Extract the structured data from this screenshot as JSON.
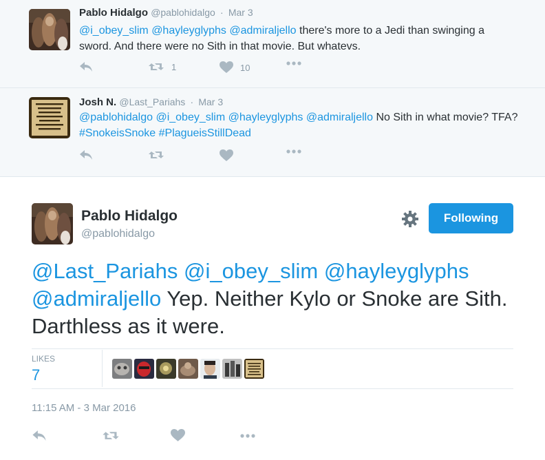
{
  "replies": [
    {
      "name": "Pablo Hidalgo",
      "handle": "@pablohidalgo",
      "date": "Mar 3",
      "text_segments": [
        {
          "text": "@i_obey_slim",
          "link": true
        },
        {
          "text": " ",
          "link": false
        },
        {
          "text": "@hayleyglyphs",
          "link": true
        },
        {
          "text": " ",
          "link": false
        },
        {
          "text": "@admiraljello",
          "link": true
        },
        {
          "text": " there's more to a Jedi than swinging a sword. And there were no Sith in that movie. But whatevs.",
          "link": false
        }
      ],
      "retweets": "1",
      "likes": "10",
      "avatar_icon": "hooded-figures-avatar"
    },
    {
      "name": "Josh N.",
      "handle": "@Last_Pariahs",
      "date": "Mar 3",
      "text_segments": [
        {
          "text": "@pablohidalgo",
          "link": true
        },
        {
          "text": " ",
          "link": false
        },
        {
          "text": "@i_obey_slim",
          "link": true
        },
        {
          "text": " ",
          "link": false
        },
        {
          "text": "@hayleyglyphs",
          "link": true
        },
        {
          "text": " ",
          "link": false
        },
        {
          "text": "@admiraljello",
          "link": true
        },
        {
          "text": " No Sith in what movie? TFA? ",
          "link": false
        },
        {
          "text": "#SnokeisSnoke",
          "link": true
        },
        {
          "text": " ",
          "link": false
        },
        {
          "text": "#PlagueisStillDead",
          "link": true
        }
      ],
      "retweets": "",
      "likes": "",
      "avatar_icon": "text-poster-avatar",
      "avatar_text": "PEOPLE DON'T COME TO HERE THE TRUTH BECAUSE THEY DON'T WANT THEIR ILLUSIONS DESTROYED."
    }
  ],
  "main_tweet": {
    "name": "Pablo Hidalgo",
    "handle": "@pablohidalgo",
    "follow_label": "Following",
    "text_segments": [
      {
        "text": "@Last_Pariahs",
        "link": true
      },
      {
        "text": " ",
        "link": false
      },
      {
        "text": "@i_obey_slim",
        "link": true
      },
      {
        "text": " ",
        "link": false
      },
      {
        "text": "@hayleyglyphs",
        "link": true
      },
      {
        "text": " ",
        "link": false
      },
      {
        "text": "@admiraljello",
        "link": true
      },
      {
        "text": " Yep. Neither Kylo or Snoke are Sith. Darthless as it were.",
        "link": false
      }
    ],
    "likes_label": "LIKES",
    "likes_count": "7",
    "timestamp": "11:15 AM - 3 Mar 2016",
    "liker_count": 7
  },
  "colors": {
    "accent": "#1b95e0",
    "reply_bg": "#f5f8fa",
    "muted": "#8899a6"
  }
}
